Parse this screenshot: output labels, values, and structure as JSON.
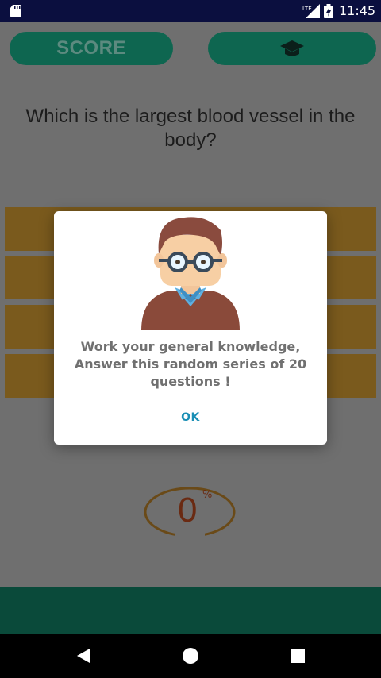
{
  "status_bar": {
    "time": "11:45",
    "icons": [
      "sd-card-icon",
      "lte-signal-icon",
      "battery-charging-icon"
    ],
    "network_label": "LTE"
  },
  "header": {
    "score_label": "SCORE",
    "grad_icon": "graduation-cap-icon"
  },
  "question": {
    "text": "Which is the largest blood vessel in the body?"
  },
  "answers": [
    "",
    "",
    "",
    ""
  ],
  "progress": {
    "value": "0",
    "unit": "%"
  },
  "dialog": {
    "message": "Work your general knowledge, Answer this random series of 20 questions !",
    "ok_label": "OK",
    "avatar_icon": "man-with-glasses-avatar"
  },
  "nav": {
    "icons": [
      "back-icon",
      "home-icon",
      "recents-icon"
    ]
  },
  "colors": {
    "status_bar": "#0b0f3f",
    "pill_bg": "#0e6650",
    "answer_bg": "#7a5a1d",
    "bottom_bar": "#0a4a3a",
    "ok_text": "#1b8fb5"
  }
}
